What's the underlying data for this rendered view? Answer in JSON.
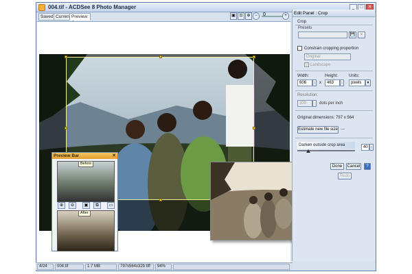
{
  "window": {
    "title": "004.tif - ACDSee 8 Photo Manager"
  },
  "tabs": [
    {
      "label": "Saved"
    },
    {
      "label": "Current"
    },
    {
      "label": "Preview: Crop"
    }
  ],
  "toolbar": {
    "zoom_value": "0"
  },
  "preview_bar": {
    "title": "Preview Bar",
    "before_label": "Before",
    "after_label": "After"
  },
  "edit_panel": {
    "title": "Edit Panel : Crop",
    "section": "Crop",
    "presets_label": "Presets",
    "presets_value": "",
    "constrain_label": "Constrain cropping proportion",
    "original_value": "Original",
    "landscape_label": "Landscape",
    "width_label": "Width:",
    "width_value": "606",
    "height_label": "Height:",
    "height_value": "463",
    "times": "x",
    "units_label": "Units:",
    "units_value": "pixels",
    "resolution_label": "Resolution:",
    "resolution_value": "300",
    "dpi_label": "dots per inch",
    "original_dimensions": "Original dimensions: 797 x 564",
    "estimate_button": "Estimate new file size",
    "estimate_result": "---",
    "darken_label": "Darken outside crop area",
    "darken_value": "40",
    "done_button": "Done",
    "cancel_button": "Cancel",
    "redo_button": "Redo"
  },
  "status": {
    "index": "4/24",
    "filename": "004.tif",
    "filesize": "1.7 MB",
    "dims": "797x564x32b tiff",
    "zoom": "94%"
  }
}
